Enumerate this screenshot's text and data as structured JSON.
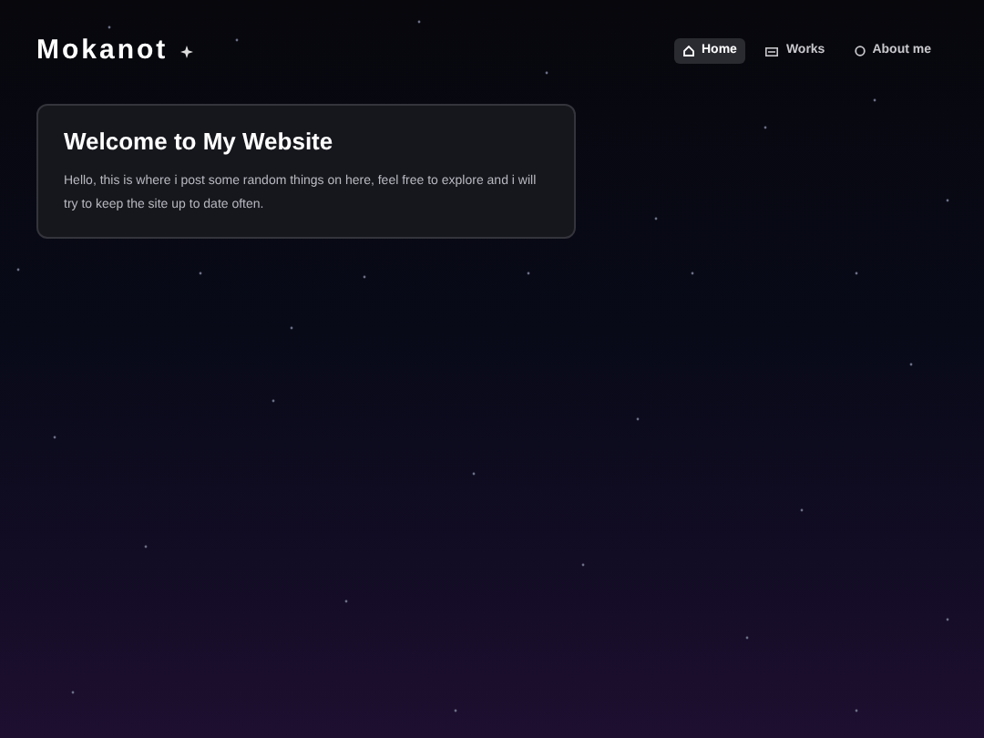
{
  "site_title": "Mokanot",
  "nav": [
    {
      "label": "Home",
      "selected": true
    },
    {
      "label": "Works",
      "selected": false
    },
    {
      "label": "About me",
      "selected": false
    }
  ],
  "card": {
    "title": "Welcome to My Website",
    "text": "Hello, this is where i post some random things on here, feel free to explore and i will try to keep the site up to date often."
  }
}
